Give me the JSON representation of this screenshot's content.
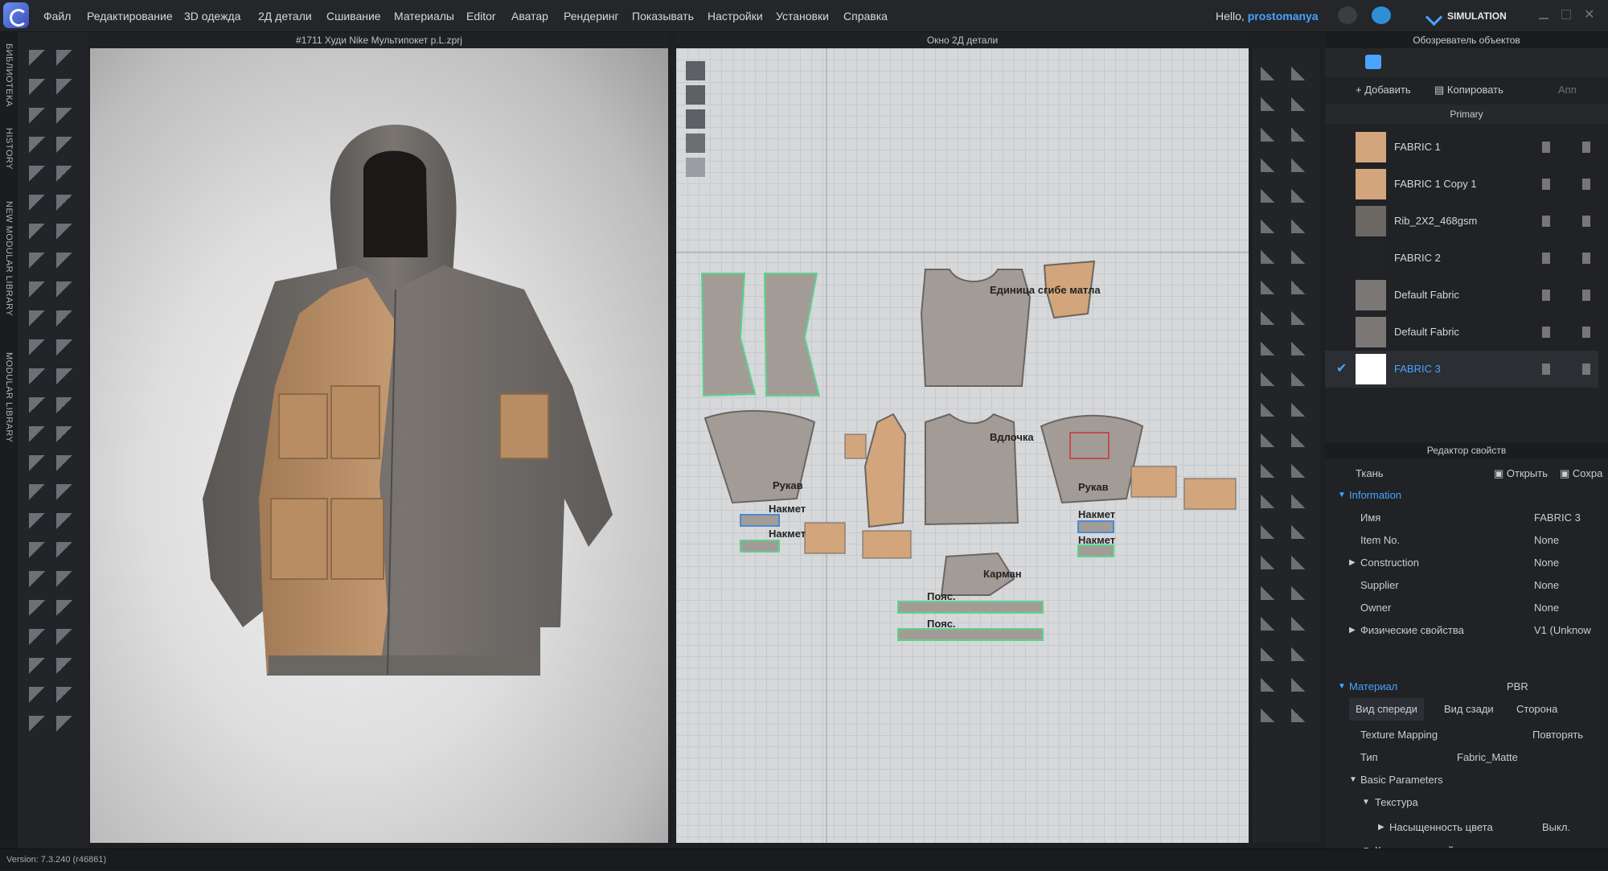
{
  "menu": [
    "Файл",
    "Редактирование",
    "3D одежда",
    "2Д детали",
    "Сшивание",
    "Материалы",
    "Editor",
    "Аватар",
    "Рендеринг",
    "Показывать",
    "Настройки",
    "Установки",
    "Справка"
  ],
  "hello_prefix": "Hello,",
  "username": "prostomanya",
  "simulation_label": "SIMULATION",
  "side_tabs": [
    "БИБЛИОТЕКА",
    "HISTORY",
    "NEW MODULAR LIBRARY",
    "MODULAR LIBRARY"
  ],
  "viewport3d_title": "#1711 Худи Nike Мультипокет p.L.zprj",
  "window2d_title": "Окно 2Д детали",
  "object_browser": {
    "title": "Обозреватель объектов",
    "add_label": "Добавить",
    "copy_label": "Копировать",
    "apply_label": "Апп",
    "colorway": "Primary",
    "fabrics": [
      {
        "name": "FABRIC 1",
        "color": "#d2a57c",
        "selected": false
      },
      {
        "name": "FABRIC 1 Copy 1",
        "color": "#d2a57c",
        "selected": false
      },
      {
        "name": "Rib_2X2_468gsm",
        "color": "#6b6762",
        "selected": false
      },
      {
        "name": "FABRIC 2",
        "color": "#222326",
        "selected": false
      },
      {
        "name": "Default Fabric",
        "color": "#7a7775",
        "selected": false
      },
      {
        "name": "Default Fabric",
        "color": "#7a7775",
        "selected": false
      },
      {
        "name": "FABRIC 3",
        "color": "#ffffff",
        "selected": true
      }
    ]
  },
  "property_editor": {
    "title": "Редактор свойств",
    "type_label": "Ткань",
    "open_label": "Открыть",
    "save_label": "Сохра",
    "information": "Information",
    "rows": [
      {
        "k": "Имя",
        "v": "FABRIC 3",
        "indent": 1,
        "arrow": ""
      },
      {
        "k": "Item No.",
        "v": "None",
        "indent": 1,
        "arrow": ""
      },
      {
        "k": "Construction",
        "v": "None",
        "indent": 1,
        "arrow": "▶"
      },
      {
        "k": "Supplier",
        "v": "None",
        "indent": 1,
        "arrow": ""
      },
      {
        "k": "Owner",
        "v": "None",
        "indent": 1,
        "arrow": ""
      },
      {
        "k": "Физические свойства",
        "v": "V1 (Unknow",
        "indent": 1,
        "arrow": "▶"
      }
    ],
    "material": "Материал",
    "material_value": "PBR",
    "tabs": [
      "Вид спереди",
      "Вид сзади",
      "Сторона"
    ],
    "texture_mapping": "Texture Mapping",
    "texture_mapping_value": "Повторять",
    "type_key": "Тип",
    "type_value": "Fabric_Matte",
    "basic_params": "Basic Parameters",
    "texture": "Текстура",
    "saturation": "Насыщенность цвета",
    "saturation_value": "Выкл.",
    "normal_map": "Карта нормалей"
  },
  "pattern_labels": {
    "yoke_text": "Единица сгибе матла",
    "sleeve": "Рукав",
    "pocket": "Карман",
    "pocket2": "Накмет",
    "front": "Вдлочка",
    "waistband": "Пояс."
  },
  "version": "Version: 7.3.240 (r46861)"
}
